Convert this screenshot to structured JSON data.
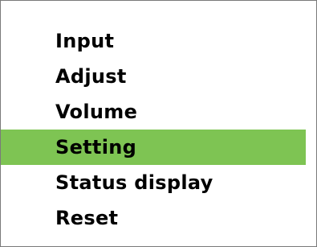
{
  "menu": {
    "items": [
      {
        "label": "Input",
        "selected": false
      },
      {
        "label": "Adjust",
        "selected": false
      },
      {
        "label": "Volume",
        "selected": false
      },
      {
        "label": "Setting",
        "selected": true
      },
      {
        "label": "Status display",
        "selected": false
      },
      {
        "label": "Reset",
        "selected": false
      }
    ],
    "highlight_color": "#7ec453",
    "border_color": "#7a7a7a"
  }
}
